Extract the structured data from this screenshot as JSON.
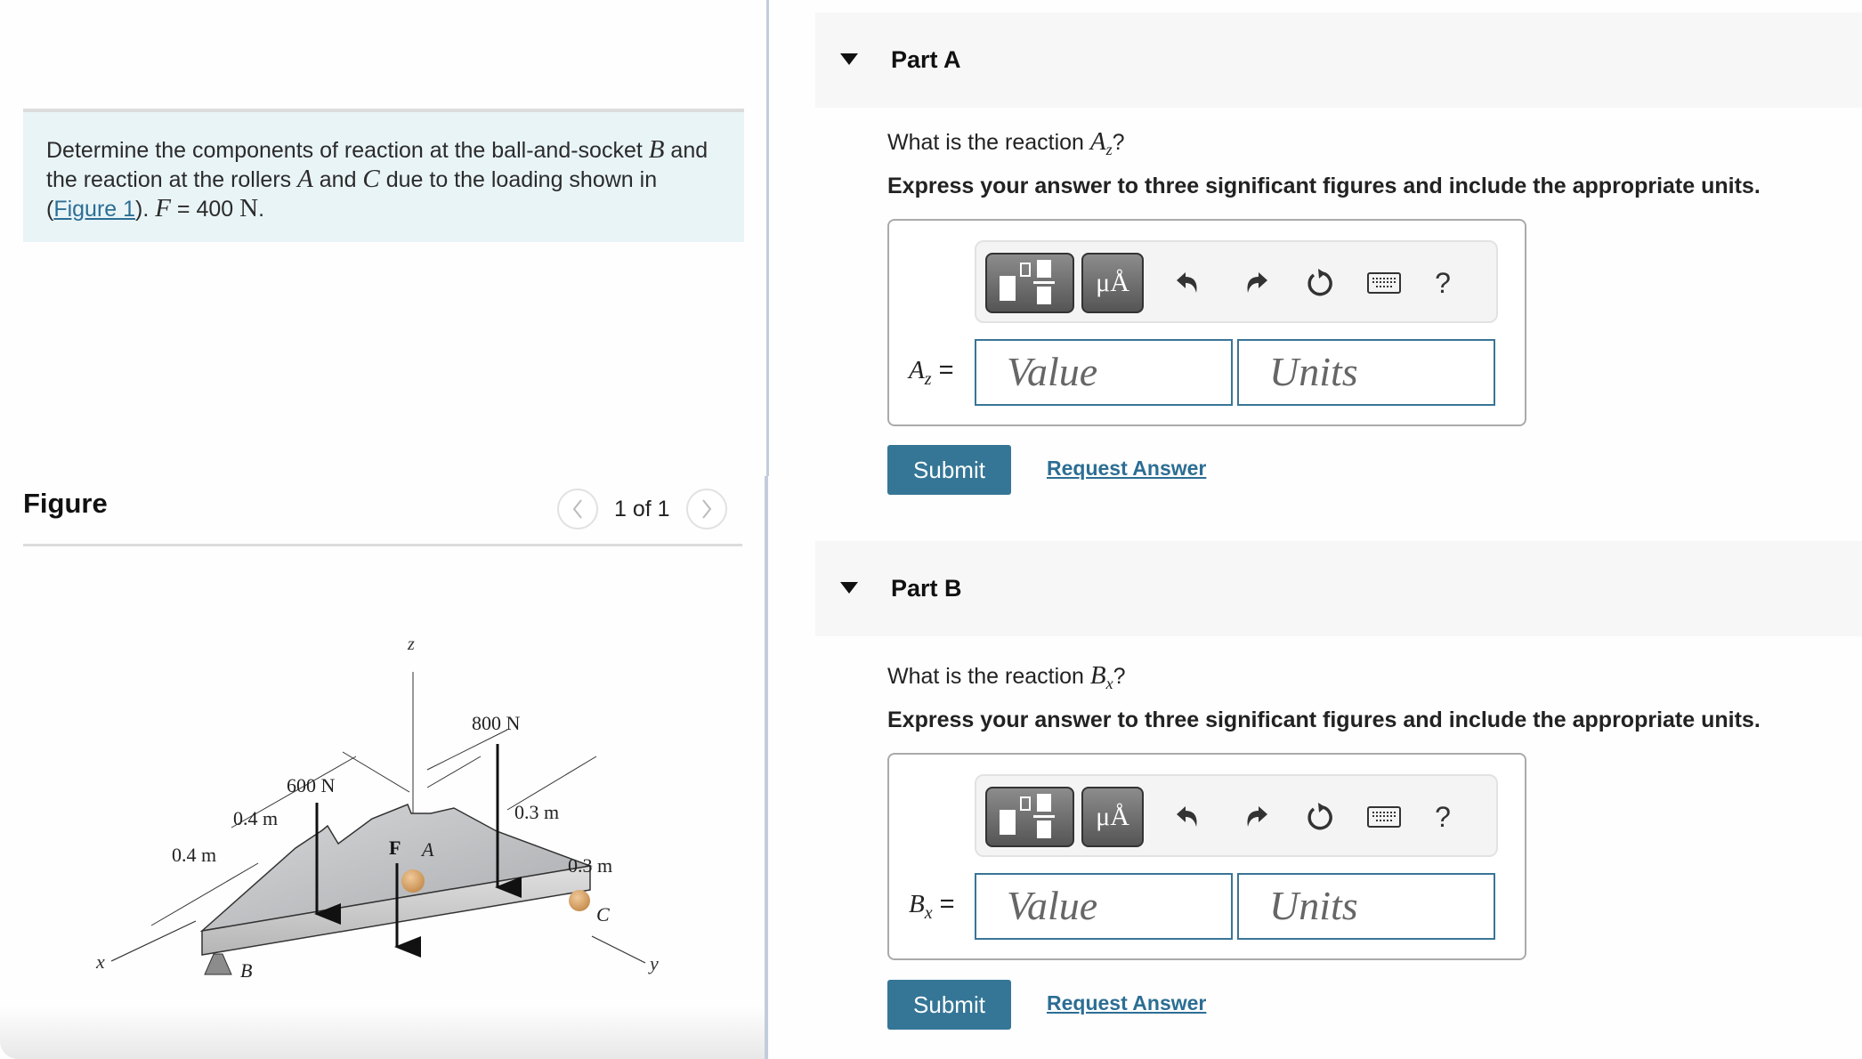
{
  "problem": {
    "text_1": "Determine the components of reaction at the ball-and-socket ",
    "var_B": "B",
    "text_2": " and the reaction at the rollers ",
    "var_A": "A",
    "text_3": " and ",
    "var_C": "C",
    "text_4": " due to the loading shown in (",
    "figure_link": "Figure 1",
    "text_5": "). ",
    "var_F": "F",
    "text_6": " = 400 ",
    "unit_N": "N",
    "text_7": "."
  },
  "figure": {
    "title": "Figure",
    "pager_text": "1 of 1",
    "prev_icon": "chevron-left-icon",
    "next_icon": "chevron-right-icon",
    "labels": {
      "z_axis": "z",
      "x_axis": "x",
      "y_axis": "y",
      "force_600": "600 N",
      "force_800": "800 N",
      "force_F": "F",
      "point_A": "A",
      "point_B": "B",
      "point_C": "C",
      "dim_04_top": "0.4 m",
      "dim_04_bottom": "0.4 m",
      "dim_03_top": "0.3 m",
      "dim_03_bottom": "0.3 m"
    }
  },
  "parts": [
    {
      "title": "Part A",
      "question_prefix": "What is the reaction ",
      "var": "A",
      "sub": "z",
      "question_suffix": "?",
      "instruction": "Express your answer to three significant figures and include the appropriate units.",
      "value_placeholder": "Value",
      "units_placeholder": "Units",
      "submit_label": "Submit",
      "request_label": "Request Answer"
    },
    {
      "title": "Part B",
      "question_prefix": "What is the reaction ",
      "var": "B",
      "sub": "x",
      "question_suffix": "?",
      "instruction": "Express your answer to three significant figures and include the appropriate units.",
      "value_placeholder": "Value",
      "units_placeholder": "Units",
      "submit_label": "Submit",
      "request_label": "Request Answer"
    }
  ],
  "toolbar": {
    "units_button": "μÅ",
    "help": "?",
    "icons": [
      "templates-icon",
      "units-icon",
      "undo-icon",
      "redo-icon",
      "reset-icon",
      "keyboard-icon",
      "help-icon"
    ]
  },
  "colors": {
    "accent": "#357696",
    "link": "#2c6e94",
    "problem_bg": "#e9f4f7",
    "part_header_bg": "#f7f7f7"
  }
}
